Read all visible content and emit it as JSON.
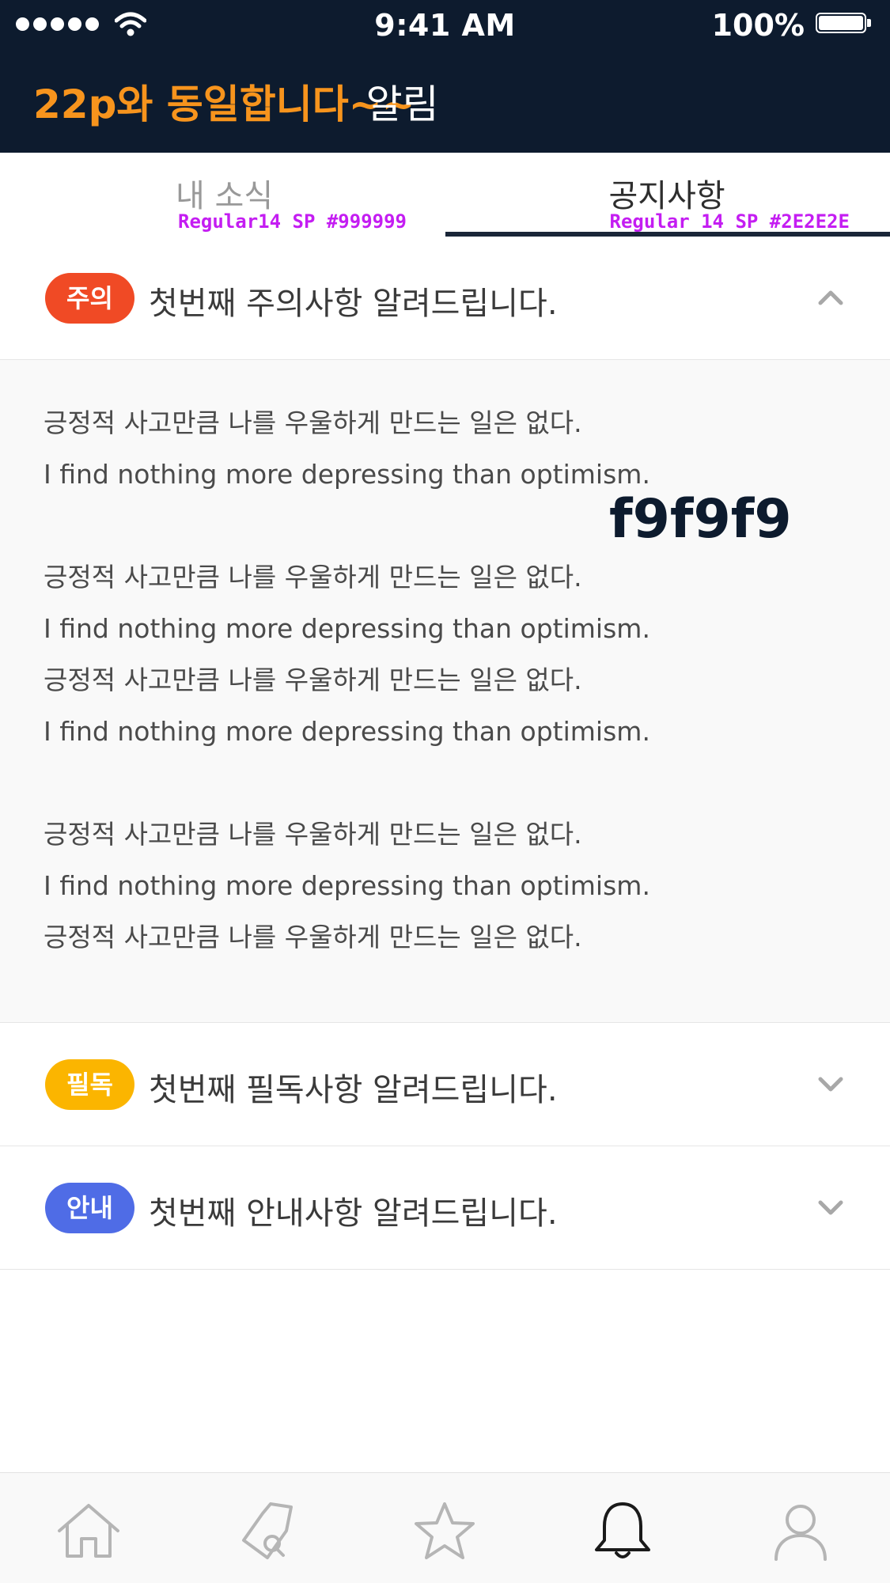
{
  "status_bar": {
    "time": "9:41 AM",
    "battery": "100%"
  },
  "header": {
    "annotation": "22p와 동일합니다~~",
    "title": "알림"
  },
  "tabs": [
    {
      "label": "내 소식",
      "spec": "Regular14 SP #999999",
      "active": false
    },
    {
      "label": "공지사항",
      "spec": "Regular 14 SP #2E2E2E",
      "active": true
    }
  ],
  "notices": [
    {
      "badge": "주의",
      "badge_color": "#F04A25",
      "title": "첫번째 주의사항 알려드립니다.",
      "expanded": true,
      "chevron": "chevron-up-icon"
    },
    {
      "badge": "필독",
      "badge_color": "#FBB500",
      "title": "첫번째 필독사항 알려드립니다.",
      "expanded": false,
      "chevron": "chevron-down-icon"
    },
    {
      "badge": "안내",
      "badge_color": "#4F6CE6",
      "title": "첫번째 안내사항 알려드립니다.",
      "expanded": false,
      "chevron": "chevron-down-icon"
    }
  ],
  "notice_body": {
    "lines": [
      "긍정적 사고만큼 나를 우울하게 만드는 일은 없다.",
      "I find nothing more depressing than optimism.",
      "",
      "긍정적 사고만큼 나를 우울하게 만드는 일은 없다.",
      "I find nothing more depressing than optimism.",
      "긍정적 사고만큼 나를 우울하게 만드는 일은 없다.",
      "I find nothing more depressing than optimism.",
      "",
      "긍정적 사고만큼 나를 우울하게 만드는 일은 없다.",
      "I find nothing more depressing than optimism.",
      "긍정적 사고만큼 나를 우울하게 만드는 일은 없다."
    ],
    "background_spec": "f9f9f9"
  },
  "bottom_nav": [
    {
      "icon": "home-icon",
      "active": false
    },
    {
      "icon": "tag-search-icon",
      "active": false
    },
    {
      "icon": "star-icon",
      "active": false
    },
    {
      "icon": "bell-icon",
      "active": true
    },
    {
      "icon": "user-icon",
      "active": false
    }
  ],
  "colors": {
    "header_bg": "#0D1B2E",
    "annotation": "#F7941D",
    "spec_note": "#C41DF2",
    "body_bg": "#F9F9F9",
    "nav_inactive": "#B5B5B5",
    "nav_active": "#1A1A1A"
  }
}
